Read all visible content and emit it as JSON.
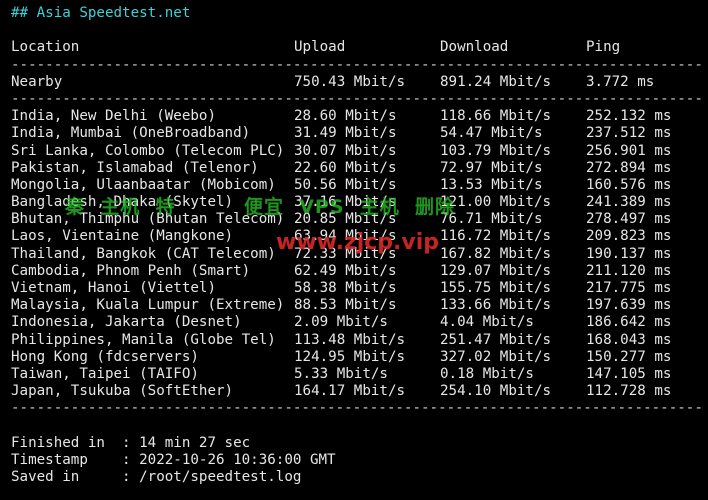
{
  "title": "## Asia Speedtest.net",
  "columns": {
    "location": "Location",
    "upload": "Upload",
    "download": "Download",
    "ping": "Ping"
  },
  "rule": "-------------------------------------------------------------------------------------------------",
  "nearby": {
    "location": "Nearby",
    "upload": "750.43 Mbit/s",
    "download": "891.24 Mbit/s",
    "ping": "3.772 ms"
  },
  "rows": [
    {
      "location": "India, New Delhi (Weebo)",
      "upload": "28.60 Mbit/s",
      "download": "118.66 Mbit/s",
      "ping": "252.132 ms"
    },
    {
      "location": "India, Mumbai (OneBroadband)",
      "upload": "31.49 Mbit/s",
      "download": "54.47 Mbit/s",
      "ping": "237.512 ms"
    },
    {
      "location": "Sri Lanka, Colombo (Telecom PLC)",
      "upload": "30.07 Mbit/s",
      "download": "103.79 Mbit/s",
      "ping": "256.901 ms"
    },
    {
      "location": "Pakistan, Islamabad (Telenor)",
      "upload": "22.60 Mbit/s",
      "download": "72.97 Mbit/s",
      "ping": "272.894 ms"
    },
    {
      "location": "Mongolia, Ulaanbaatar (Mobicom)",
      "upload": "50.56 Mbit/s",
      "download": "13.53 Mbit/s",
      "ping": "160.576 ms"
    },
    {
      "location": "Bangladesh, Dhaka (Skytel)",
      "upload": "37.16 Mbit/s",
      "download": "121.00 Mbit/s",
      "ping": "241.389 ms"
    },
    {
      "location": "Bhutan, Thimphu (Bhutan Telecom)",
      "upload": "20.85 Mbit/s",
      "download": "76.71 Mbit/s",
      "ping": "278.497 ms"
    },
    {
      "location": "Laos, Vientaine (Mangkone)",
      "upload": "63.94 Mbit/s",
      "download": "116.72 Mbit/s",
      "ping": "209.823 ms"
    },
    {
      "location": "Thailand, Bangkok (CAT Telecom)",
      "upload": "72.33 Mbit/s",
      "download": "167.82 Mbit/s",
      "ping": "190.137 ms"
    },
    {
      "location": "Cambodia, Phnom Penh (Smart)",
      "upload": "62.49 Mbit/s",
      "download": "129.07 Mbit/s",
      "ping": "211.120 ms"
    },
    {
      "location": "Vietnam, Hanoi (Viettel)",
      "upload": "58.38 Mbit/s",
      "download": "155.75 Mbit/s",
      "ping": "217.775 ms"
    },
    {
      "location": "Malaysia, Kuala Lumpur (Extreme)",
      "upload": "88.53 Mbit/s",
      "download": "133.66 Mbit/s",
      "ping": "197.639 ms"
    },
    {
      "location": "Indonesia, Jakarta (Desnet)",
      "upload": "2.09 Mbit/s",
      "download": "4.04 Mbit/s",
      "ping": "186.642 ms"
    },
    {
      "location": "Philippines, Manila (Globe Tel)",
      "upload": "113.48 Mbit/s",
      "download": "251.47 Mbit/s",
      "ping": "168.043 ms"
    },
    {
      "location": "Hong Kong (fdcservers)",
      "upload": "124.95 Mbit/s",
      "download": "327.02 Mbit/s",
      "ping": "150.277 ms"
    },
    {
      "location": "Taiwan, Taipei (TAIFO)",
      "upload": "5.33 Mbit/s",
      "download": "0.18 Mbit/s",
      "ping": "147.105 ms"
    },
    {
      "location": "Japan, Tsukuba (SoftEther)",
      "upload": "164.17 Mbit/s",
      "download": "254.10 Mbit/s",
      "ping": "112.728 ms"
    }
  ],
  "footer": {
    "finished": "Finished in  : 14 min 27 sec",
    "timestamp": "Timestamp    : 2022-10-26 10:36:00 GMT",
    "saved": "Saved in     : /root/speedtest.log"
  },
  "watermark": {
    "line1": "秦  主机  特         便宜  VPS  主机  删除",
    "line2": "www.zjcp.vip"
  }
}
